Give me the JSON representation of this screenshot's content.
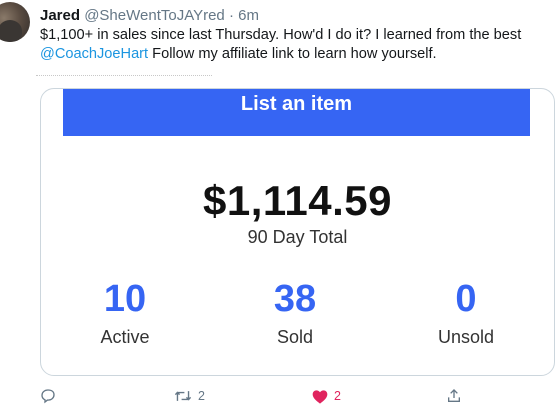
{
  "tweet": {
    "author_name": "Jared",
    "handle": "@SheWentToJAYred",
    "separator": "·",
    "time": "6m",
    "text_line1": "$1,100+ in sales since last Thursday. How'd I do it? I learned from the best",
    "mention": "@CoachJoeHart",
    "text_line2_rest": " Follow my affiliate link to learn how yourself."
  },
  "card": {
    "button_label": "List an item",
    "total_amount": "$1,114.59",
    "total_label": "90 Day Total",
    "stats": [
      {
        "value": "10",
        "label": "Active"
      },
      {
        "value": "38",
        "label": "Sold"
      },
      {
        "value": "0",
        "label": "Unsold"
      }
    ]
  },
  "actions": {
    "reply_icon": "reply-icon",
    "retweet_icon": "retweet-icon",
    "retweet_count": "2",
    "like_icon": "heart-icon",
    "like_count": "2",
    "share_icon": "share-icon"
  },
  "colors": {
    "accent_blue": "#3665f3",
    "link_blue": "#1b95e0",
    "like_red": "#e0245e",
    "muted": "#657786"
  }
}
